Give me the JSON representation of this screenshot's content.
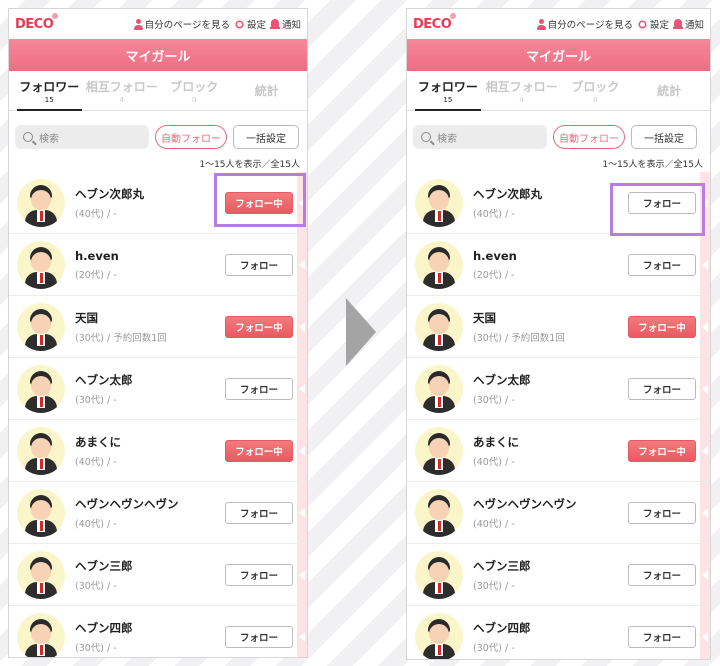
{
  "logo": "DECO",
  "topnav": {
    "mypage": "自分のページを見る",
    "settings": "設定",
    "notify": "通知"
  },
  "header_title": "マイガール",
  "tabs": [
    {
      "label": "フォロワー",
      "count": "15"
    },
    {
      "label": "相互フォロー",
      "count": "4"
    },
    {
      "label": "ブロック",
      "count": "0"
    },
    {
      "label": "統計",
      "count": ""
    }
  ],
  "search_placeholder": "検索",
  "auto_follow_label": "自動フォロー",
  "bulk_label": "一括設定",
  "count_text": "1〜15人を表示／全15人",
  "follow_label": "フォロー",
  "following_label": "フォロー中",
  "users": [
    {
      "name": "ヘブン次郎丸",
      "meta": "(40代) / -"
    },
    {
      "name": "h.even",
      "meta": "(20代) / -"
    },
    {
      "name": "天国",
      "meta": "(30代) / 予約回数1回"
    },
    {
      "name": "ヘブン太郎",
      "meta": "(30代) / -"
    },
    {
      "name": "あまくに",
      "meta": "(40代) / -"
    },
    {
      "name": "ヘヴンヘヴンヘヴン",
      "meta": "(40代) / -"
    },
    {
      "name": "ヘブン三郎",
      "meta": "(30代) / -"
    },
    {
      "name": "ヘブン四郎",
      "meta": "(30代) / -"
    }
  ],
  "before_states": [
    true,
    false,
    true,
    false,
    true,
    false,
    false,
    false
  ],
  "after_states": [
    false,
    false,
    true,
    false,
    true,
    false,
    false,
    false
  ],
  "highlight_color": "#b47ee2",
  "accent_color": "#ef6d82"
}
